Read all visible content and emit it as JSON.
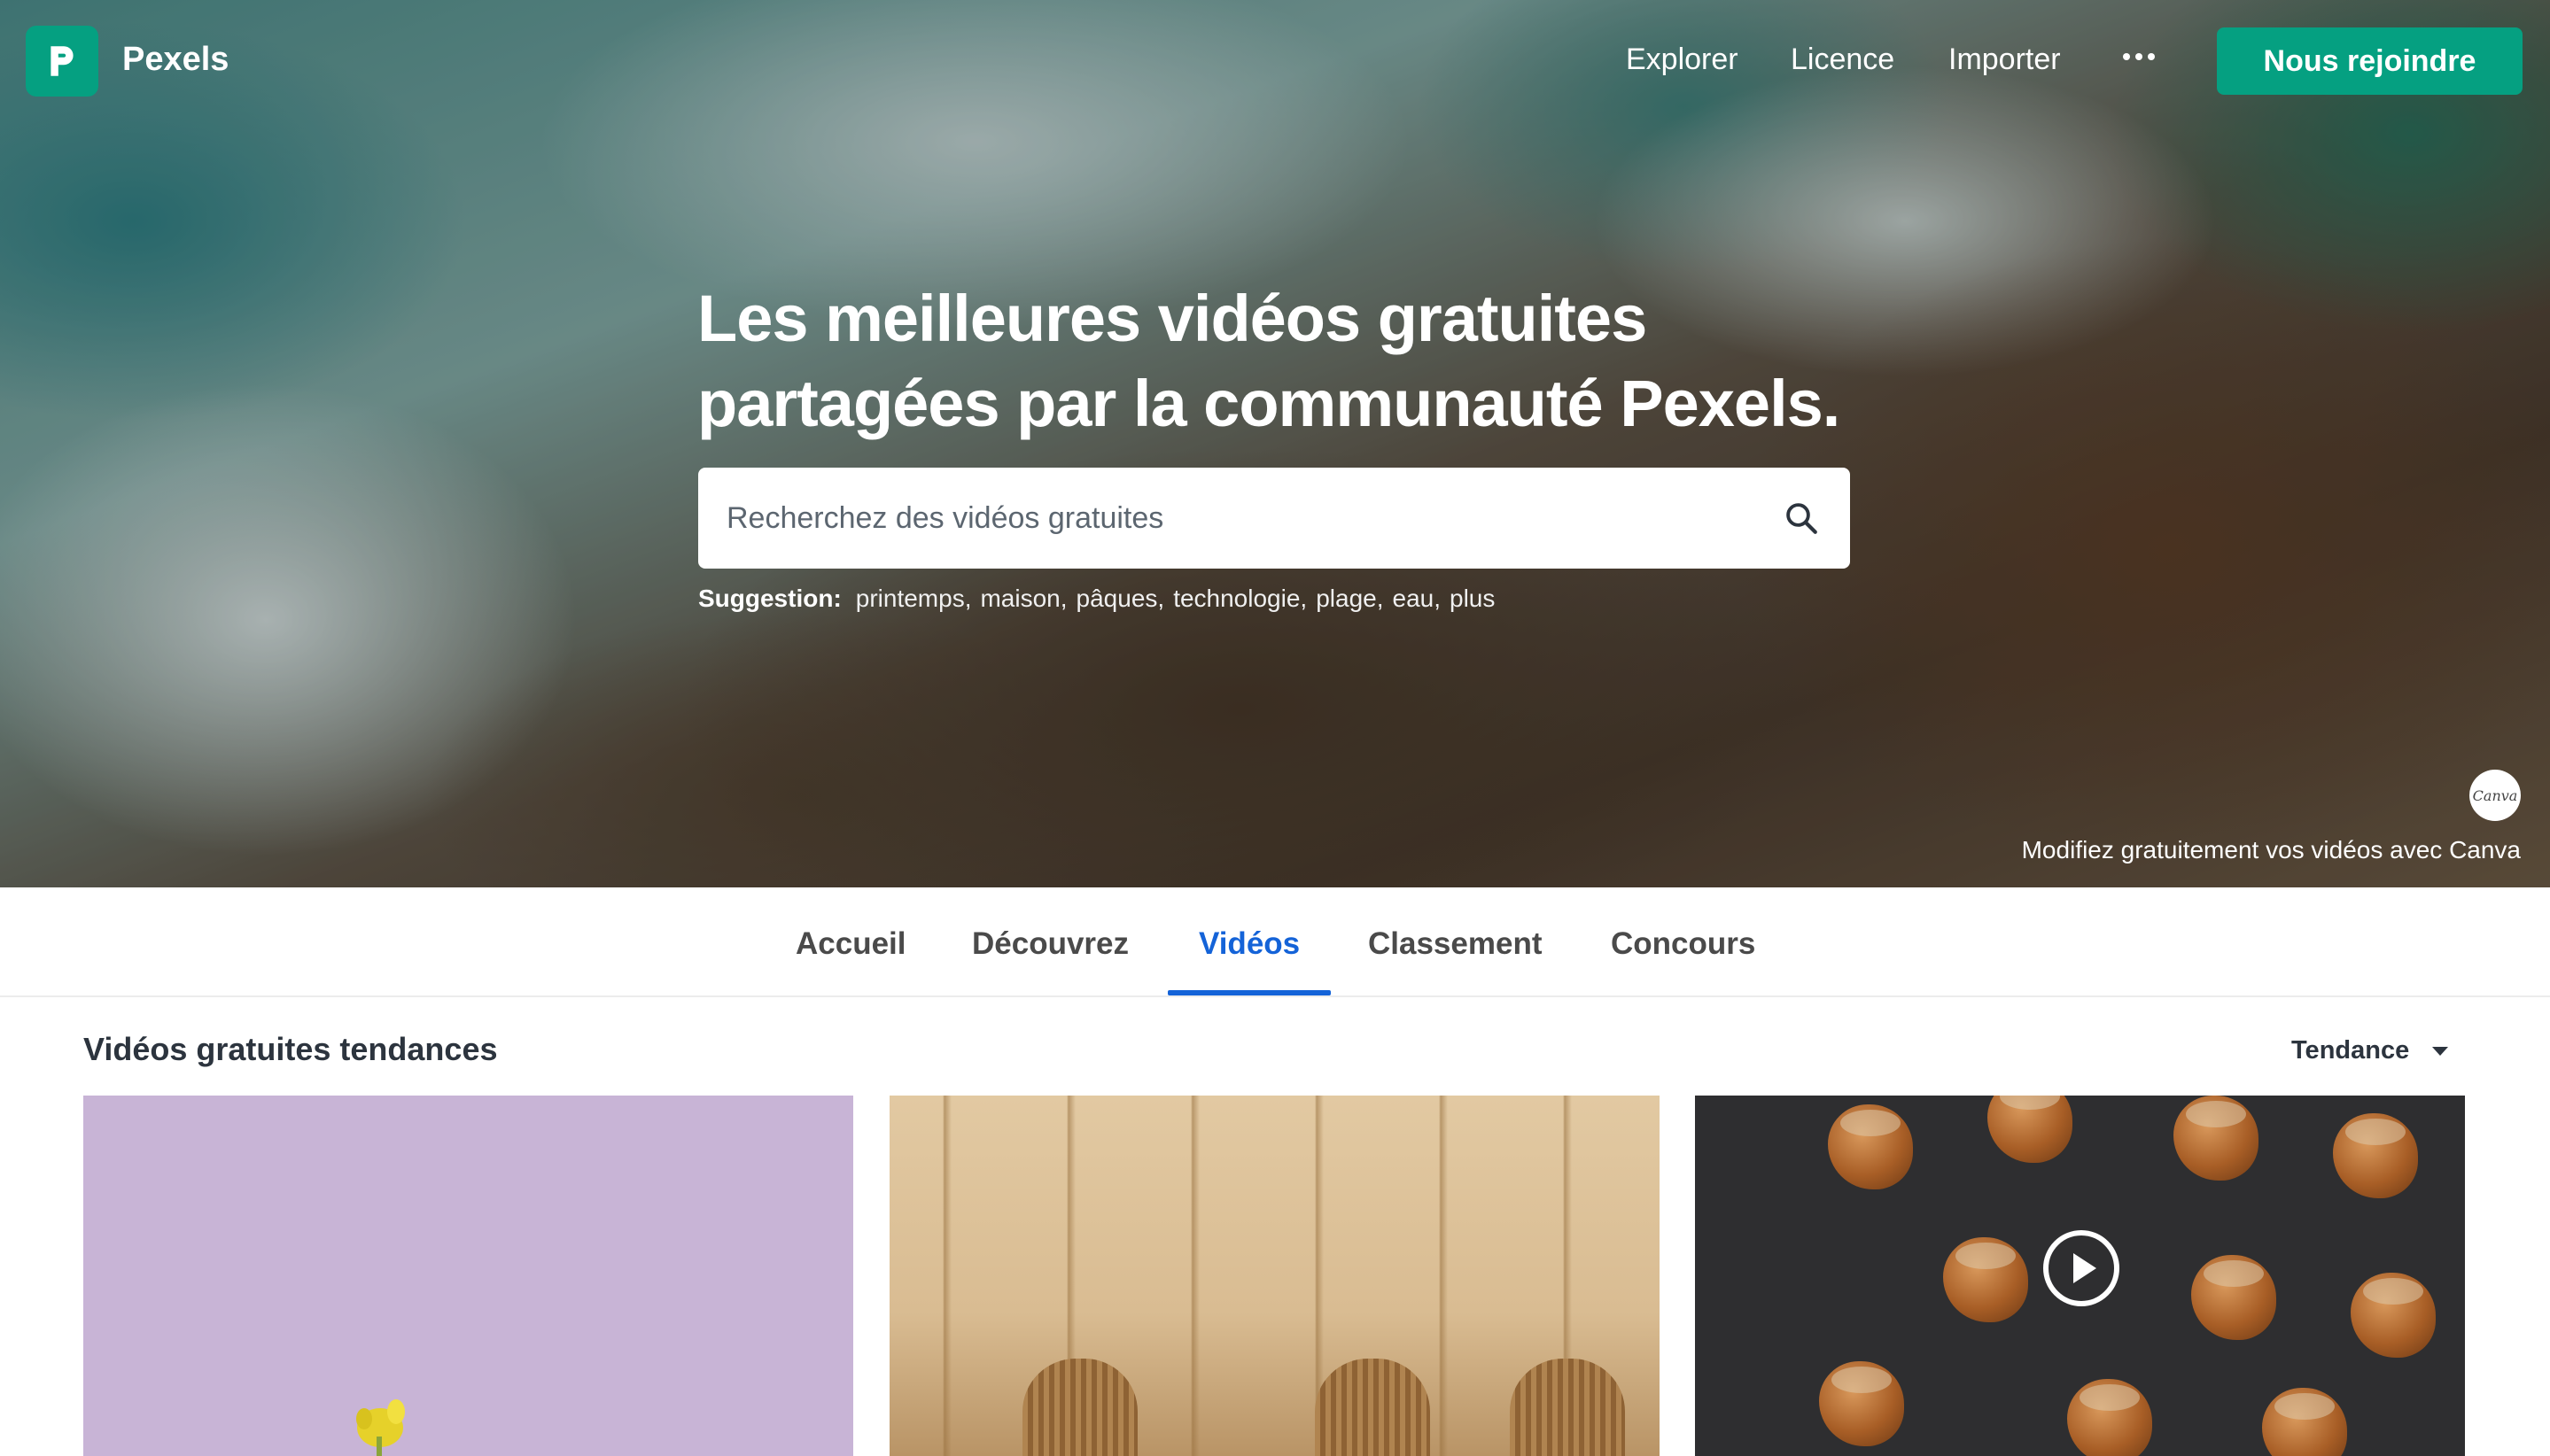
{
  "brand": {
    "name": "Pexels",
    "accent": "#05a081",
    "link_active": "#1463d8"
  },
  "topnav": {
    "explore": "Explorer",
    "license": "Licence",
    "upload": "Importer",
    "more_icon": "more-dots-icon",
    "join": "Nous rejoindre"
  },
  "hero": {
    "title_line1": "Les meilleures vidéos gratuites",
    "title_line2": "partagées par la communauté Pexels.",
    "search_placeholder": "Recherchez des vidéos gratuites",
    "suggestion_label": "Suggestion:",
    "suggestions": [
      "printemps",
      "maison",
      "pâques",
      "technologie",
      "plage",
      "eau",
      "plus"
    ],
    "canva_badge": "Canva",
    "canva_text": "Modifiez gratuitement vos vidéos avec Canva"
  },
  "tabs": [
    {
      "label": "Accueil",
      "active": false
    },
    {
      "label": "Découvrez",
      "active": false
    },
    {
      "label": "Vidéos",
      "active": true
    },
    {
      "label": "Classement",
      "active": false
    },
    {
      "label": "Concours",
      "active": false
    }
  ],
  "section": {
    "title": "Vidéos gratuites tendances",
    "sort_label": "Tendance"
  }
}
